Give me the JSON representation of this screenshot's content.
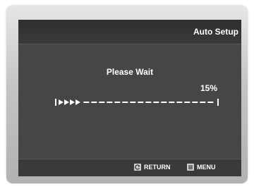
{
  "header": {
    "title": "Auto Setup"
  },
  "main": {
    "status_text": "Please Wait",
    "progress": {
      "percent_label": "15%",
      "value": 0.15
    }
  },
  "footer": {
    "return_label": "RETURN",
    "menu_label": "MENU",
    "return_icon": "return-icon",
    "menu_icon": "menu-icon"
  },
  "colors": {
    "screen_bg": "#464646",
    "header_bg": "#333333",
    "text": "#ffffff"
  }
}
